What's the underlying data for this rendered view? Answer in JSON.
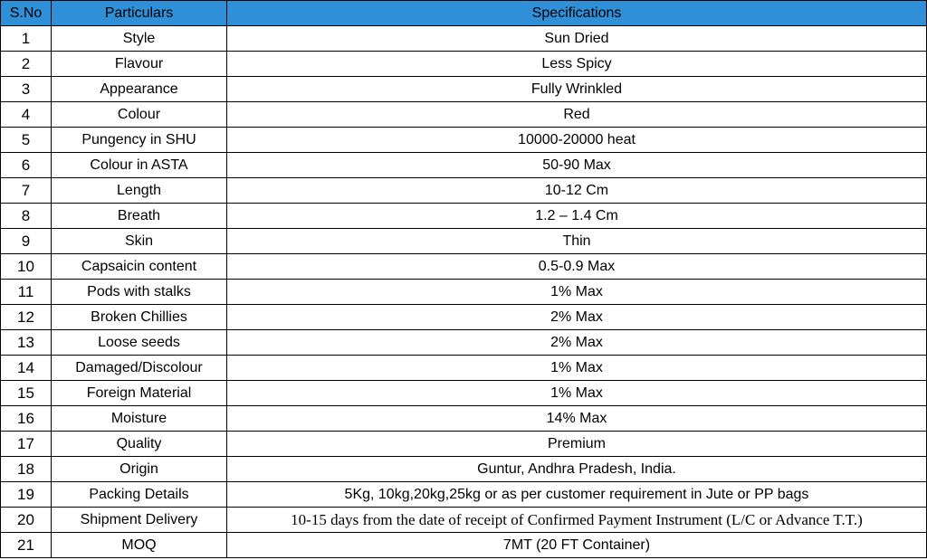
{
  "table": {
    "headers": [
      "S.No",
      "Particulars",
      "Specifications"
    ],
    "header_bg": "#2f8fd7",
    "rows": [
      {
        "sno": "1",
        "particular": "Style",
        "spec": "Sun Dried"
      },
      {
        "sno": "2",
        "particular": "Flavour",
        "spec": "Less Spicy"
      },
      {
        "sno": "3",
        "particular": "Appearance",
        "spec": "Fully Wrinkled"
      },
      {
        "sno": "4",
        "particular": "Colour",
        "spec": "Red"
      },
      {
        "sno": "5",
        "particular": "Pungency in SHU",
        "spec": "10000-20000 heat"
      },
      {
        "sno": "6",
        "particular": "Colour in ASTA",
        "spec": "50-90 Max"
      },
      {
        "sno": "7",
        "particular": "Length",
        "spec": "10-12 Cm"
      },
      {
        "sno": "8",
        "particular": "Breath",
        "spec": "1.2 – 1.4 Cm"
      },
      {
        "sno": "9",
        "particular": "Skin",
        "spec": "Thin"
      },
      {
        "sno": "10",
        "particular": "Capsaicin content",
        "spec": "0.5-0.9 Max"
      },
      {
        "sno": "11",
        "particular": "Pods with stalks",
        "spec": "1% Max"
      },
      {
        "sno": "12",
        "particular": "Broken Chillies",
        "spec": "2% Max"
      },
      {
        "sno": "13",
        "particular": "Loose seeds",
        "spec": "2% Max"
      },
      {
        "sno": "14",
        "particular": "Damaged/Discolour",
        "spec": "1% Max"
      },
      {
        "sno": "15",
        "particular": "Foreign Material",
        "spec": "1% Max"
      },
      {
        "sno": "16",
        "particular": "Moisture",
        "spec": "14% Max"
      },
      {
        "sno": "17",
        "particular": "Quality",
        "spec": "Premium"
      },
      {
        "sno": "18",
        "particular": "Origin",
        "spec": "Guntur, Andhra Pradesh, India."
      },
      {
        "sno": "19",
        "particular": "Packing Details",
        "spec": "5Kg, 10kg,20kg,25kg or as per customer requirement in Jute or PP bags"
      },
      {
        "sno": "20",
        "particular": "Shipment Delivery",
        "spec": "10-15 days from the date of receipt of Confirmed Payment Instrument (L/C or Advance T.T.)"
      },
      {
        "sno": "21",
        "particular": "MOQ",
        "spec": "7MT (20 FT Container)"
      }
    ]
  }
}
